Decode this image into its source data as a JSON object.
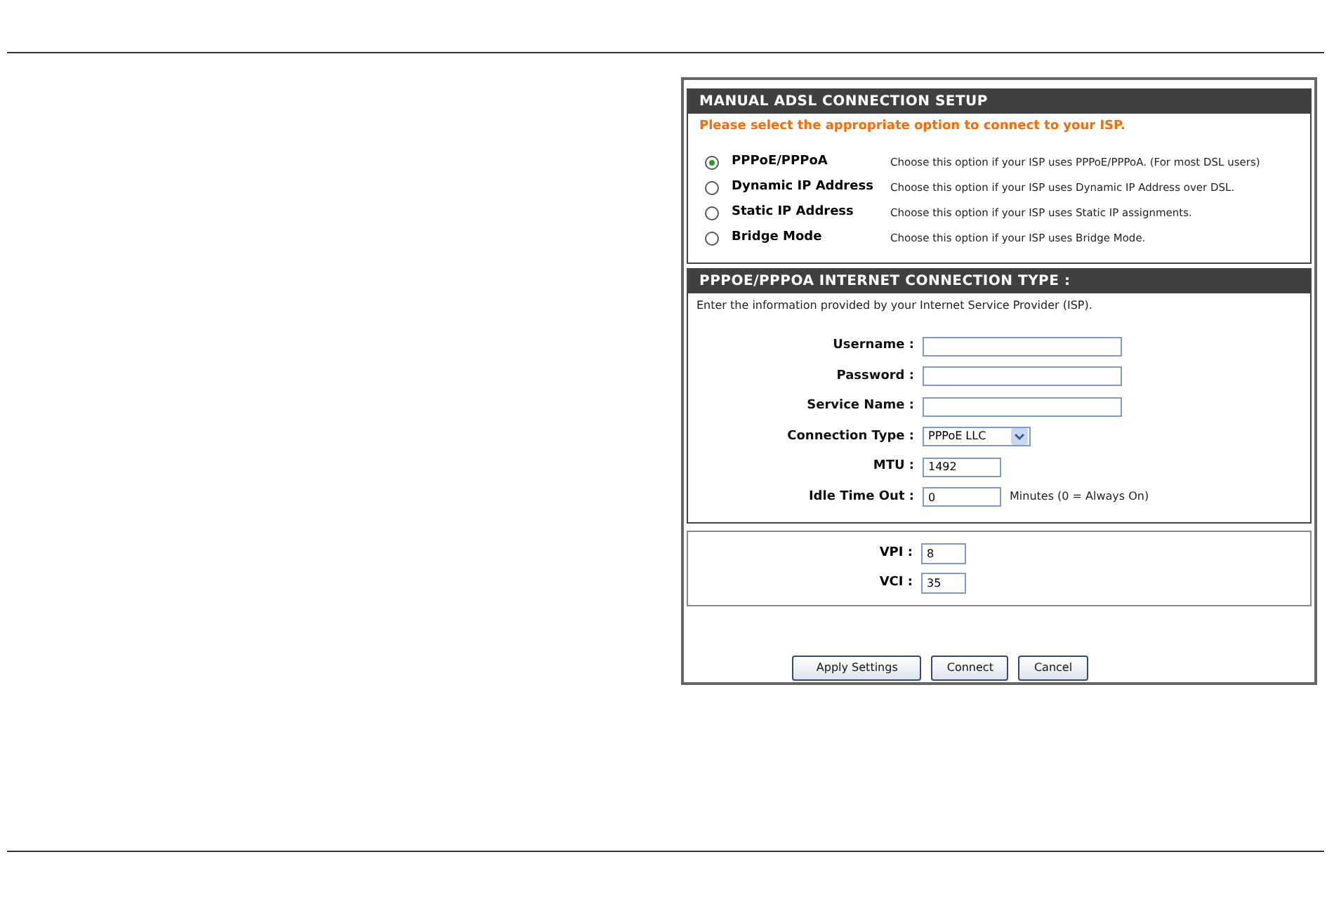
{
  "setup": {
    "title": "MANUAL ADSL CONNECTION SETUP",
    "prompt": "Please select the appropriate option to connect to your ISP.",
    "options": [
      {
        "label": "PPPoE/PPPoA",
        "description": "Choose this option if your ISP uses PPPoE/PPPoA. (For most DSL users)",
        "selected": true
      },
      {
        "label": "Dynamic IP Address",
        "description": "Choose this option if your ISP uses Dynamic IP Address over DSL.",
        "selected": false
      },
      {
        "label": "Static IP Address",
        "description": "Choose this option if your ISP uses Static IP assignments.",
        "selected": false
      },
      {
        "label": "Bridge Mode",
        "description": "Choose this option if your ISP uses Bridge Mode.",
        "selected": false
      }
    ]
  },
  "connection": {
    "title": "PPPOE/PPPOA INTERNET CONNECTION TYPE :",
    "intro": "Enter the information provided by your Internet Service Provider (ISP).",
    "fields": [
      {
        "kind": "text",
        "label": "Username :"
      },
      {
        "kind": "text",
        "label": "Password :"
      },
      {
        "kind": "text",
        "label": "Service Name :"
      },
      {
        "kind": "select",
        "label": "Connection Type :",
        "value": "PPPoE LLC"
      },
      {
        "kind": "number",
        "label": "MTU :",
        "value": "1492"
      },
      {
        "kind": "number",
        "label": "Idle Time Out :",
        "value": "0",
        "suffix": "Minutes (0 = Always On)"
      }
    ]
  },
  "atm": {
    "fields": [
      {
        "label": "VPI :",
        "value": "8"
      },
      {
        "label": "VCI :",
        "value": "35"
      }
    ]
  },
  "buttons": [
    "Apply Settings",
    "Connect",
    "Cancel"
  ]
}
